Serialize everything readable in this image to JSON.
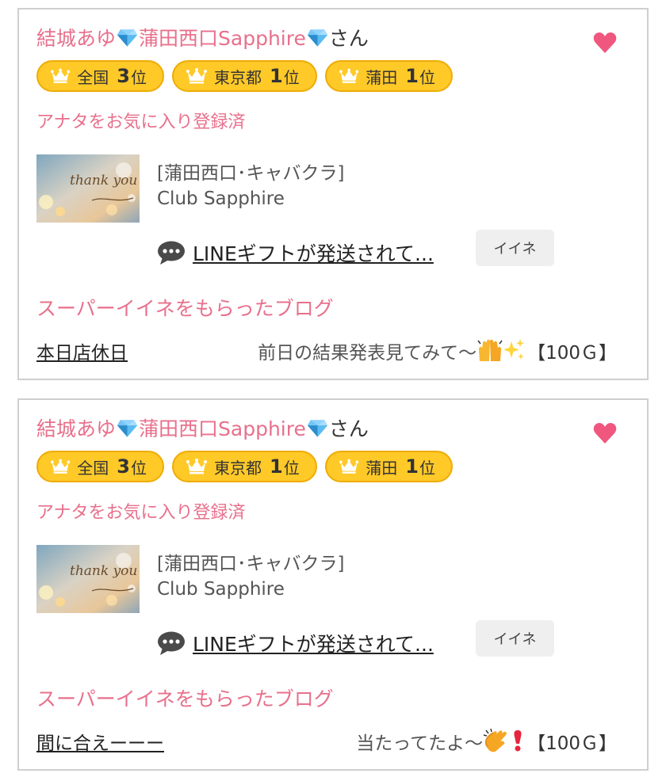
{
  "cards": [
    {
      "user_name": "結城あゆ",
      "store_label": "蒲田西口Sapphire",
      "suffix": "さん",
      "ranks": [
        {
          "region": "全国",
          "rank": "3",
          "unit": "位"
        },
        {
          "region": "東京都",
          "rank": "1",
          "unit": "位"
        },
        {
          "region": "蒲田",
          "rank": "1",
          "unit": "位"
        }
      ],
      "favorite_status": "アナタをお気に入り登録済",
      "category": "[蒲田西口･キャバクラ]",
      "shop_name": "Club Sapphire",
      "thumbnail_text": "thank you",
      "message_link": "LINEギフトが発送されて...",
      "iine_button": "イイネ",
      "blog_heading": "スーパーイイネをもらったブログ",
      "blog_title": "本日店休日",
      "blog_snippet": "前日の結果発表見てみて〜",
      "blog_emoji": [
        "raised-hands-emoji",
        "sparkles-emoji"
      ],
      "blog_price": "【100Ｇ】"
    },
    {
      "user_name": "結城あゆ",
      "store_label": "蒲田西口Sapphire",
      "suffix": "さん",
      "ranks": [
        {
          "region": "全国",
          "rank": "3",
          "unit": "位"
        },
        {
          "region": "東京都",
          "rank": "1",
          "unit": "位"
        },
        {
          "region": "蒲田",
          "rank": "1",
          "unit": "位"
        }
      ],
      "favorite_status": "アナタをお気に入り登録済",
      "category": "[蒲田西口･キャバクラ]",
      "shop_name": "Club Sapphire",
      "thumbnail_text": "thank you",
      "message_link": "LINEギフトが発送されて...",
      "iine_button": "イイネ",
      "blog_heading": "スーパーイイネをもらったブログ",
      "blog_title": "間に合えーーー",
      "blog_snippet": "当たってたよ〜",
      "blog_emoji": [
        "clapping-hands-emoji",
        "exclamation-emoji"
      ],
      "blog_price": "【100Ｇ】"
    }
  ],
  "colors": {
    "accent_pink": "#e8708c",
    "heart": "#f0577e",
    "badge_fill": "#ffc928",
    "badge_border": "#eeac06",
    "gem": "#3fa9e8"
  }
}
